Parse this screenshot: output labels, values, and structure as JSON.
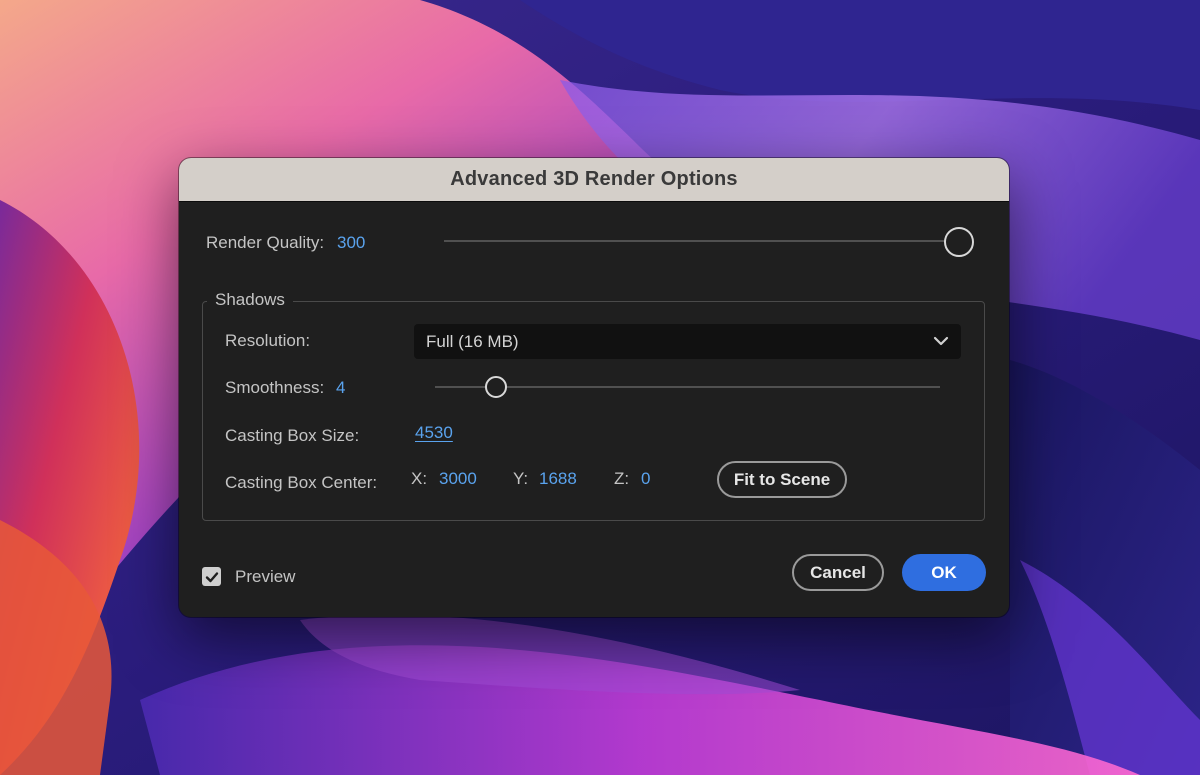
{
  "dialog": {
    "title": "Advanced 3D Render Options"
  },
  "render_quality": {
    "label": "Render Quality:",
    "value": "300",
    "slider_fraction": 1.0
  },
  "shadows": {
    "legend": "Shadows",
    "resolution": {
      "label": "Resolution:",
      "selected": "Full (16 MB)"
    },
    "smoothness": {
      "label": "Smoothness:",
      "value": "4",
      "slider_fraction": 0.12
    },
    "casting_box_size": {
      "label": "Casting Box Size:",
      "value": "4530"
    },
    "casting_box_center": {
      "label": "Casting Box Center:",
      "x_label": "X:",
      "x_value": "3000",
      "y_label": "Y:",
      "y_value": "1688",
      "z_label": "Z:",
      "z_value": "0",
      "fit_button": "Fit to Scene"
    }
  },
  "footer": {
    "preview_label": "Preview",
    "preview_checked": true,
    "cancel_label": "Cancel",
    "ok_label": "OK"
  },
  "colors": {
    "accent": "#2f6ee0",
    "value_text": "#5aa3ee",
    "titlebar": "#d4cfc9",
    "dialog_bg": "#1f1f1f"
  },
  "icons": {
    "dropdown": "chevron-down-icon",
    "checkbox": "checkmark-icon"
  }
}
